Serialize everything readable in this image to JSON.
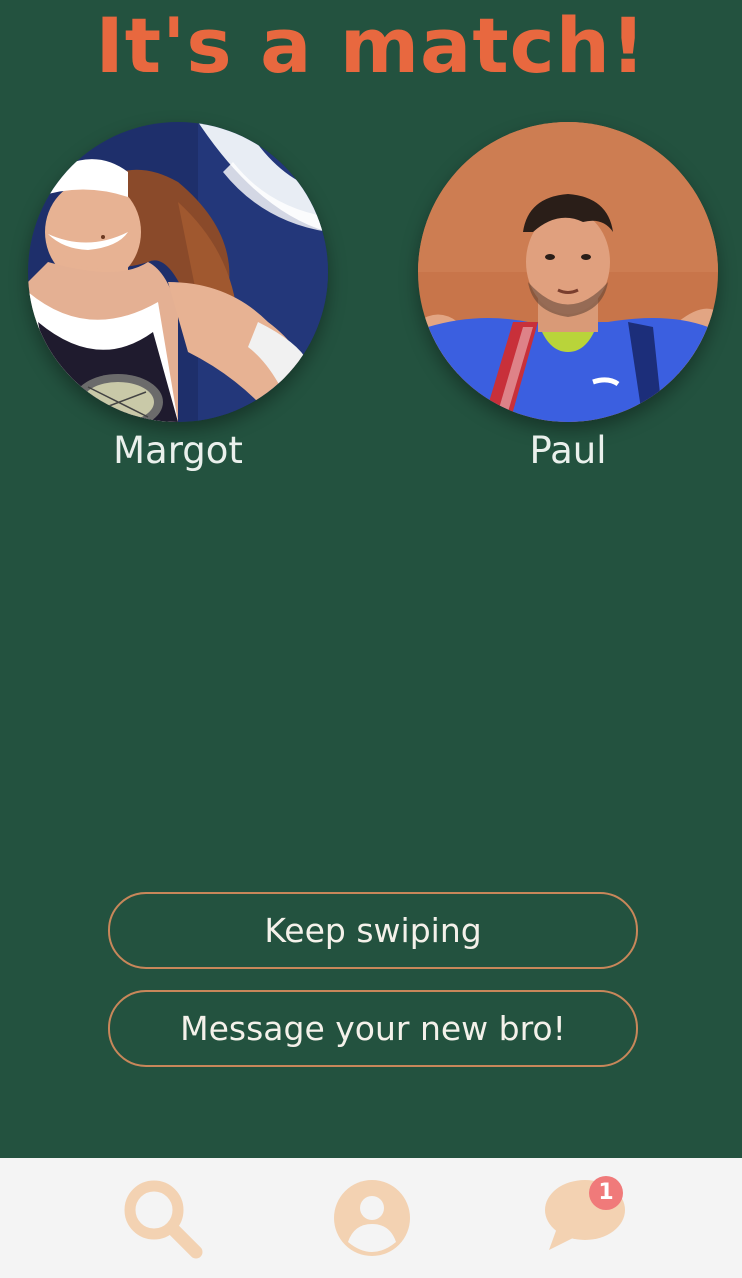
{
  "match": {
    "title": "It's a match!"
  },
  "profiles": {
    "left": {
      "name": "Margot",
      "photo": "woman-tennis-player-photo"
    },
    "right": {
      "name": "Paul",
      "photo": "man-tennis-player-photo"
    }
  },
  "actions": {
    "keep_swiping_label": "Keep swiping",
    "message_label": "Message your new bro!"
  },
  "tabbar": {
    "items": [
      {
        "icon": "search-icon"
      },
      {
        "icon": "profile-icon"
      },
      {
        "icon": "chat-icon",
        "badge": "1"
      }
    ]
  },
  "colors": {
    "background": "#23523f",
    "title": "#e8683f",
    "button_border": "#c8875a",
    "tab_icon": "#f3d2b2",
    "tabbar_bg": "#f4f4f4",
    "badge": "#f07a7a"
  }
}
